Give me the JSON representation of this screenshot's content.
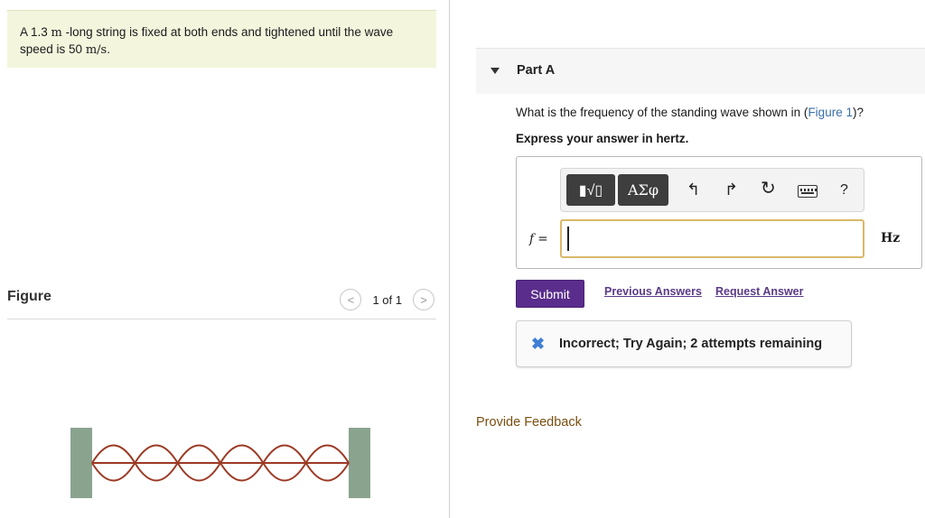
{
  "problem": {
    "text_1": "A 1.3 ",
    "unit_m": "m",
    "text_2": " -long string is fixed at both ends and tightened until the wave",
    "text_3": "speed is 50 ",
    "unit_ms": "m/s",
    "text_4": "."
  },
  "figure": {
    "title": "Figure",
    "prev_glyph": "<",
    "next_glyph": ">",
    "pager_text": "1 of 1",
    "wave_antinodes": 6,
    "wall_color": "#8aa38f",
    "string_color": "#9c3a24"
  },
  "part": {
    "title": "Part A",
    "question_pre": "What is the frequency of the standing wave shown in (",
    "question_link": "Figure 1",
    "question_post": ")?",
    "instructions": "Express your answer in hertz."
  },
  "toolbar": {
    "templates_label": "▮√▯",
    "greek_label": "ΑΣφ",
    "undo_glyph": "↰",
    "redo_glyph": "↱",
    "reset_glyph": "↻",
    "help_glyph": "?"
  },
  "answer": {
    "variable": "f",
    "equals": " =",
    "value": "",
    "unit": "Hz"
  },
  "actions": {
    "submit_label": "Submit",
    "previous_answers_label": "Previous Answers",
    "request_answer_label": "Request Answer"
  },
  "feedback": {
    "icon_glyph": "✖",
    "message": "Incorrect; Try Again; 2 attempts remaining",
    "icon_color": "#3f7fd6"
  },
  "footer": {
    "provide_feedback_label": "Provide Feedback"
  },
  "colors": {
    "problem_bg": "#f3f6dd",
    "submit_bg": "#5a2d8c",
    "input_border": "#d9b86a",
    "link_color": "#5a3a86"
  }
}
